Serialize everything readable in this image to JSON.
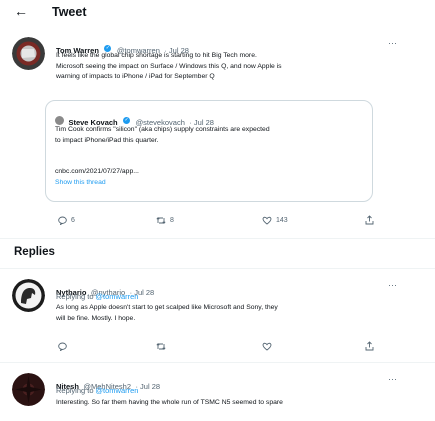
{
  "header": {
    "title": "Tweet"
  },
  "tweet": {
    "name": "Tom Warren",
    "handle": "@tomwarren",
    "date": "· Jul 28",
    "more": "···",
    "line1": "It feels like the global chip shortage is starting to hit Big Tech more.",
    "line2": "Microsoft seeing the impact on Surface / Windows this Q, and now Apple is",
    "line3": "warning of impacts to iPhone / iPad for September Q",
    "quote": {
      "name": "Steve Kovach",
      "handle": "@stevekovach",
      "date": "· Jul 28",
      "line1": "Tim Cook confirms \"silicon\" (aka chips) supply constraints are expected",
      "line2": "to impact iPhone/iPad this quarter.",
      "link": "cnbc.com/2021/07/27/app...",
      "show_thread": "Show this thread"
    },
    "actions": {
      "replies": "6",
      "retweets": "8",
      "likes": "143"
    }
  },
  "replies_section": {
    "title": "Replies"
  },
  "replies": [
    {
      "name": "Nythario",
      "handle": "@nythario",
      "date": "· Jul 28",
      "more": "···",
      "replying_prefix": "Replying to",
      "replying_to": "@tomwarren",
      "line1": "As long as Apple doesn't start to get scalped like Microsoft and Sony, they",
      "line2": "will be fine. Mostly. I hope."
    },
    {
      "name": "Nitesh",
      "handle": "@MehNitesh2",
      "date": "· Jul 28",
      "more": "···",
      "replying_prefix": "Replying to",
      "replying_to": "@tomwarren",
      "line1": "Interesting. So far them having the whole run of TSMC N5 seemed to spare"
    }
  ],
  "colors": {
    "accent": "#1d9bf0",
    "muted": "#536471",
    "border": "#cfd9de"
  },
  "icons": [
    "back-arrow-icon",
    "verified-icon",
    "more-icon",
    "reply-icon",
    "retweet-icon",
    "like-icon",
    "share-icon"
  ]
}
